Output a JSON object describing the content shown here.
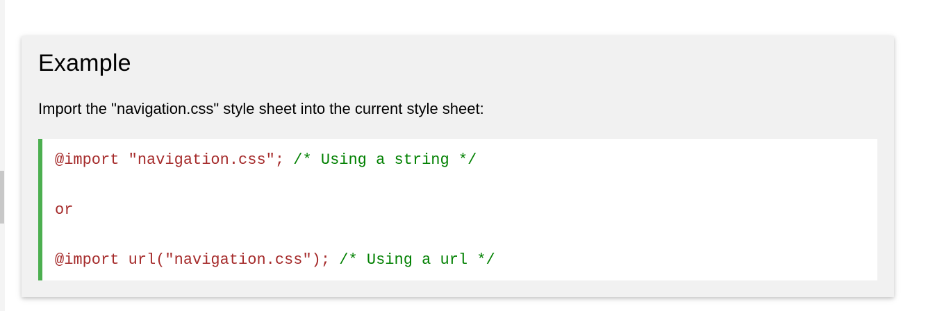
{
  "example": {
    "title": "Example",
    "description": "Import the \"navigation.css\" style sheet into the current style sheet:",
    "code": {
      "line1": {
        "code": "@import \"navigation.css\"; ",
        "comment": "/* Using a string */"
      },
      "line2": {
        "code": "or"
      },
      "line3": {
        "code": "@import url(\"navigation.css\"); ",
        "comment": "/* Using a url */"
      }
    }
  },
  "colors": {
    "panel_background": "#f1f1f1",
    "code_background": "#ffffff",
    "code_accent_border": "#4caf50",
    "code_text": "#a52a2a",
    "code_comment": "#008000"
  }
}
